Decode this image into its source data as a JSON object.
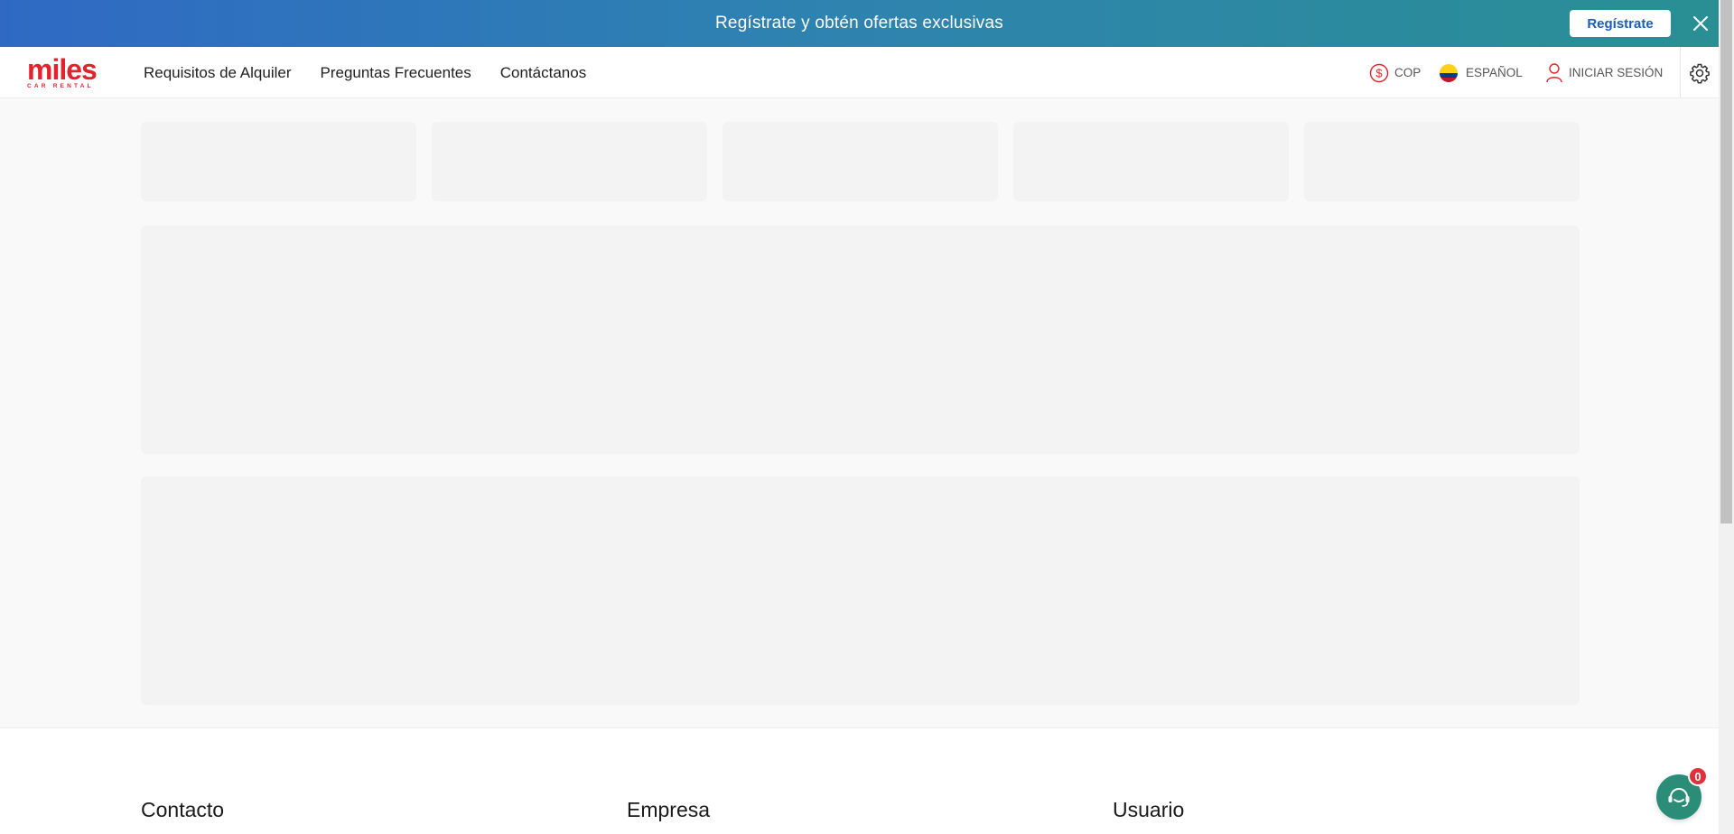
{
  "promo": {
    "text": "Regístrate y obtén ofertas exclusivas",
    "button_label": "Regístrate",
    "close_icon": "close-icon"
  },
  "nav": {
    "logo_word": "miles",
    "logo_sub": "CAR RENTAL",
    "links": [
      {
        "label": "Requisitos de Alquiler"
      },
      {
        "label": "Preguntas Frecuentes"
      },
      {
        "label": "Contáctanos"
      }
    ],
    "currency": {
      "label": "COP",
      "icon": "dollar-circle-icon"
    },
    "language": {
      "label": "ESPAÑOL",
      "icon": "colombia-flag-icon"
    },
    "login": {
      "label": "INICIAR SESIÓN",
      "icon": "user-icon"
    },
    "settings_icon": "gear-icon"
  },
  "footer": {
    "columns": [
      "Contacto",
      "Empresa",
      "Usuario"
    ]
  },
  "chat": {
    "badge_count": "0",
    "icon": "chat-support-icon"
  },
  "colors": {
    "brand_red": "#e4222d",
    "banner_start": "#2f69c4",
    "banner_end": "#2a8f94",
    "skeleton": "#f3f3f3",
    "chat_green": "#2b8c78"
  }
}
